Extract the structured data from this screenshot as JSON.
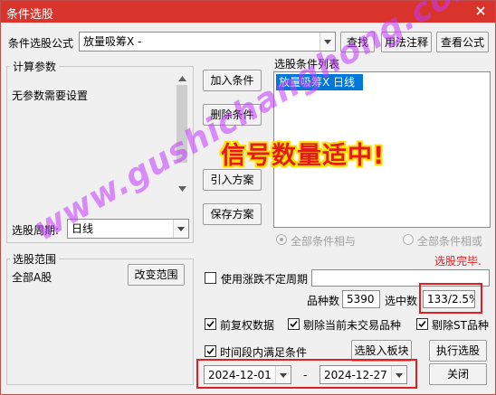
{
  "window": {
    "title": "条件选股"
  },
  "formula": {
    "label": "条件选股公式",
    "selected": "放量吸筹X  -",
    "find_label": "查找",
    "usage_label": "用法注释",
    "view_label": "查看公式"
  },
  "params": {
    "group_title": "计算参数",
    "text": "无参数需要设置",
    "period_label": "选股周期:",
    "period_value": "日线"
  },
  "actions": {
    "add": "加入条件",
    "remove": "删除条件",
    "import": "引入方案",
    "save": "保存方案"
  },
  "condlist": {
    "title": "选股条件列表",
    "items": [
      "放量吸筹X  日线"
    ],
    "radio_and": "全部条件相与",
    "radio_or": "全部条件相或"
  },
  "status": {
    "done": "选股完毕."
  },
  "range": {
    "group_title": "选股范围",
    "value": "全部A股",
    "change_label": "改变范围"
  },
  "options": {
    "limit_label": "使用涨跌不定周期",
    "count_label": "品种数",
    "count_value": "5390",
    "selected_label": "选中数",
    "selected_value": "133/2.5%",
    "restore_label": "前复权数据",
    "exclude_untraded_label": "剔除当前未交易品种",
    "exclude_st_label": "剔除ST品种",
    "period_range_label": "时间段内满足条件",
    "to_block_label": "选股入板块",
    "run_label": "执行选股",
    "date_start": "2024-12-01",
    "date_sep": "-",
    "date_end": "2024-12-27",
    "close_label": "关闭"
  },
  "overlay": {
    "promo": "信号数量适中!",
    "watermark": "www.gushichanghong.com"
  },
  "colors": {
    "titlebar": "#d9342b",
    "selection": "#0078d7",
    "highlight_box": "#e02020",
    "promo": "#e41b1b"
  }
}
